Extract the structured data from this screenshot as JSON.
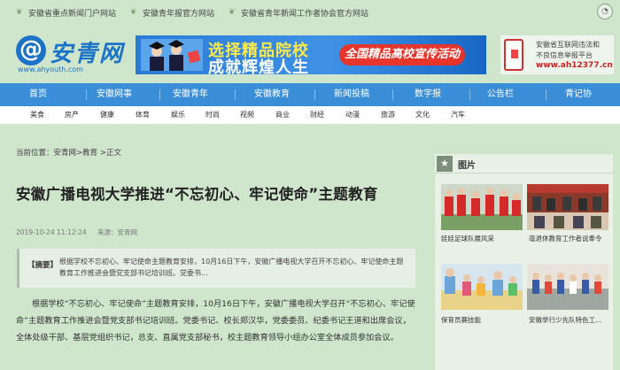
{
  "topbar": {
    "links": [
      {
        "label": "安徽省重点新闻门户网站",
        "icon": "leaf-icon"
      },
      {
        "label": "安徽青年报官方网站",
        "icon": "leaf-icon"
      },
      {
        "label": "安徽省青年新闻工作者协会官方网站",
        "icon": "leaf-icon"
      }
    ]
  },
  "logo": {
    "symbol": "@",
    "name": "安青网",
    "url": "www.ahyouth.com"
  },
  "banner": {
    "line1": "选择精品院校",
    "line2": "成就辉煌人生",
    "pill": "全国精品高校宣传活动"
  },
  "report": {
    "line1": "安徽省互联网违法和",
    "line2": "不良信息举报平台",
    "site": "www.ah12377.cn"
  },
  "nav": {
    "items": [
      "首页",
      "安徽网事",
      "安徽青年",
      "安徽教育",
      "新闻投稿",
      "数字报",
      "公告栏",
      "青记协"
    ]
  },
  "subnav": {
    "items": [
      "美食",
      "房产",
      "健康",
      "体育",
      "娱乐",
      "时尚",
      "视频",
      "商业",
      "财经",
      "动漫",
      "旅游",
      "文化",
      "汽车"
    ]
  },
  "article": {
    "breadcrumb": "当前位置：安青网>教育 >正文",
    "title": "安徽广播电视大学推进“不忘初心、牢记使命”主题教育",
    "date": "2019-10-24 11:12:24",
    "source": "来源：安青网",
    "summary_tag": "【摘要】",
    "summary": "根据学校不忘初心、牢记使命主题教育安排，10月16日下午，安徽广播电视大学召开不忘初心、牢记使命主题教育工作推进会暨党支部书记培训班。党委书...",
    "body": "根据学校“不忘初心、牢记使命”主题教育安排，10月16日下午，安徽广播电视大学召开“不忘初心、牢记使命”主题教育工作推进会暨党支部书记培训班。党委书记、校长郑汉华，党委委员、纪委书记王道和出席会议，全体处级干部、基层党组织书记，总支、直属党支部秘书，校主题教育领导小组办公室全体成员参加会议。"
  },
  "sidebar": {
    "heading": "图片",
    "icon": "star-icon",
    "photos": [
      {
        "caption": "娃娃足球队展风采"
      },
      {
        "caption": "亳退休教育工作者说奉令"
      },
      {
        "caption": "保育员赛技能"
      },
      {
        "caption": "安徽举行少先队特色工..."
      }
    ]
  }
}
